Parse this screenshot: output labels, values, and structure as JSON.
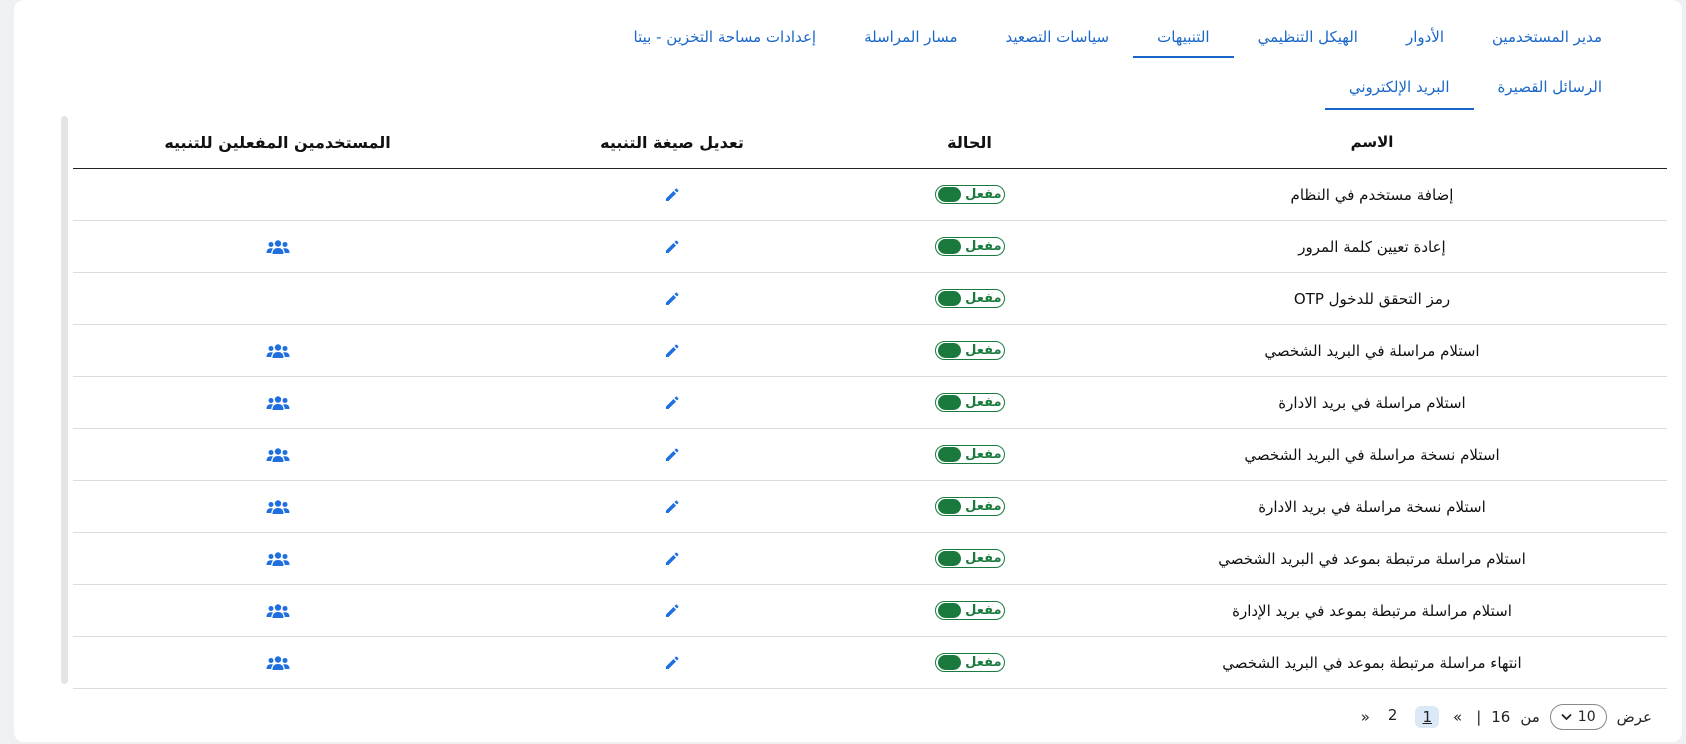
{
  "tabs": [
    {
      "label": "مدير المستخدمين",
      "active": false
    },
    {
      "label": "الأدوار",
      "active": false
    },
    {
      "label": "الهيكل التنظيمي",
      "active": false
    },
    {
      "label": "التنبيهات",
      "active": true
    },
    {
      "label": "سياسات التصعيد",
      "active": false
    },
    {
      "label": "مسار المراسلة",
      "active": false
    },
    {
      "label": "إعدادات مساحة التخزين - بيتا",
      "active": false
    }
  ],
  "subtabs": [
    {
      "label": "الرسائل القصيرة",
      "active": false
    },
    {
      "label": "البريد الإلكتروني",
      "active": true
    }
  ],
  "table": {
    "headers": {
      "name": "الاسم",
      "status": "الحالة",
      "edit": "تعديل صيغة التنبيه",
      "users": "المستخدمين المفعلين للتنبيه"
    },
    "rows": [
      {
        "name": "إضافة مستخدم في النظام",
        "status": "مفعل",
        "has_users": false
      },
      {
        "name": "إعادة تعيين كلمة المرور",
        "status": "مفعل",
        "has_users": true
      },
      {
        "name": "OTP رمز التحقق للدخول",
        "status": "مفعل",
        "has_users": false
      },
      {
        "name": "استلام مراسلة في البريد الشخصي",
        "status": "مفعل",
        "has_users": true
      },
      {
        "name": "استلام مراسلة في بريد الادارة",
        "status": "مفعل",
        "has_users": true
      },
      {
        "name": "استلام نسخة مراسلة في البريد الشخصي",
        "status": "مفعل",
        "has_users": true
      },
      {
        "name": "استلام نسخة مراسلة في بريد الادارة",
        "status": "مفعل",
        "has_users": true
      },
      {
        "name": "استلام مراسلة مرتبطة بموعد في البريد الشخصي",
        "status": "مفعل",
        "has_users": true
      },
      {
        "name": "استلام مراسلة مرتبطة بموعد في بريد الإدارة",
        "status": "مفعل",
        "has_users": true
      },
      {
        "name": "انتهاء مراسلة مرتبطة بموعد في البريد الشخصي",
        "status": "مفعل",
        "has_users": true
      }
    ]
  },
  "pagination": {
    "show_label": "عرض",
    "page_size": "10",
    "of_label": "من",
    "total": "16",
    "separator": "|",
    "prev": "«",
    "pages": [
      "1",
      "2"
    ],
    "current": "1",
    "next": "»"
  },
  "icons": {
    "edit": "pencil-icon",
    "users": "users-group-icon",
    "dropdown": "chevron-down-icon"
  },
  "colors": {
    "accent": "#1967c8",
    "status_green": "#1a7a3e",
    "icon_blue": "#1f6fe0"
  }
}
